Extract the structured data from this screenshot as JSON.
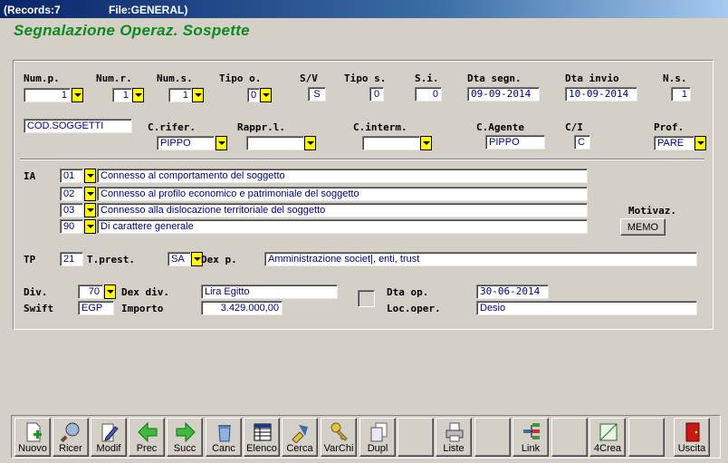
{
  "window": {
    "records": "(Records:7",
    "file": "File:GENERAL)"
  },
  "app_title": "Segnalazione Operaz. Sospette",
  "row1": {
    "num_p": {
      "label": "Num.p.",
      "value": "1"
    },
    "num_r": {
      "label": "Num.r.",
      "value": "1"
    },
    "num_s": {
      "label": "Num.s.",
      "value": "1"
    },
    "tipo_o": {
      "label": "Tipo o.",
      "value": "0"
    },
    "sv": {
      "label": "S/V",
      "value": "S"
    },
    "tipo_s": {
      "label": "Tipo s.",
      "value": "0"
    },
    "si": {
      "label": "S.i.",
      "value": "0"
    },
    "dta_segn": {
      "label": "Dta segn.",
      "value": "09-09-2014"
    },
    "dta_invio": {
      "label": "Dta invio",
      "value": "10-09-2014"
    },
    "ns": {
      "label": "N.s.",
      "value": "1"
    }
  },
  "row2": {
    "soggetti": "COD.SOGGETTI",
    "c_rifer": {
      "label": "C.rifer.",
      "value": "PIPPO"
    },
    "rappr_l": {
      "label": "Rappr.l.",
      "value": ""
    },
    "c_interm": {
      "label": "C.interm.",
      "value": ""
    },
    "c_agente": {
      "label": "C.Agente",
      "value": "PIPPO"
    },
    "ci": {
      "label": "C/I",
      "value": "C"
    },
    "prof": {
      "label": "Prof.",
      "value": "PARE"
    }
  },
  "ia": {
    "label": "IA",
    "rows": [
      {
        "code": "01",
        "text": "Connesso al comportamento del soggetto"
      },
      {
        "code": "02",
        "text": "Connesso al profilo economico e patrimoniale del soggetto"
      },
      {
        "code": "03",
        "text": "Connesso alla dislocazione territoriale del soggetto"
      },
      {
        "code": "90",
        "text": "Di carattere generale"
      }
    ],
    "motivaz_label": "Motivaz.",
    "memo_label": "MEMO"
  },
  "tp": {
    "label": "TP",
    "value": "21",
    "t_prest_label": "T.prest.",
    "t_prest_value": "SA",
    "dex_p_label": "Dex p.",
    "dex_p_value": "Amministrazione societ|, enti, trust"
  },
  "div": {
    "label": "Div.",
    "value": "70",
    "dex_div_label": "Dex div.",
    "dex_div_value": "Lira Egitto",
    "swift_label": "Swift",
    "swift_value": "EGP",
    "importo_label": "Importo",
    "importo_value": "3.429.000,00",
    "dta_op_label": "Dta op.",
    "dta_op_value": "30-06-2014",
    "loc_oper_label": "Loc.oper.",
    "loc_oper_value": "Desio"
  },
  "toolbar": {
    "buttons": [
      {
        "label": "Nuovo",
        "icon": "new-document-icon"
      },
      {
        "label": "Ricer",
        "icon": "search-icon"
      },
      {
        "label": "Modif",
        "icon": "edit-document-icon"
      },
      {
        "label": "Prec",
        "icon": "arrow-left-icon"
      },
      {
        "label": "Succ",
        "icon": "arrow-right-icon"
      },
      {
        "label": "Canc",
        "icon": "trash-icon"
      },
      {
        "label": "Elenco",
        "icon": "list-icon"
      },
      {
        "label": "Cerca",
        "icon": "find-icon"
      },
      {
        "label": "VarChi",
        "icon": "keys-icon"
      },
      {
        "label": "Dupl",
        "icon": "duplicate-icon"
      },
      {
        "label": "",
        "icon": ""
      },
      {
        "label": "Liste",
        "icon": "printer-icon"
      },
      {
        "label": "",
        "icon": ""
      },
      {
        "label": "Link",
        "icon": "link-icon"
      },
      {
        "label": "",
        "icon": ""
      },
      {
        "label": "4Crea",
        "icon": "create-icon"
      },
      {
        "label": "",
        "icon": ""
      },
      {
        "label": "Uscita",
        "icon": "exit-door-icon"
      }
    ]
  },
  "colors": {
    "title_green": "#0b8a1e",
    "field_text": "#00007f",
    "dropdown_yellow": "#ffff00",
    "window_bg": "#d4d0c8"
  }
}
